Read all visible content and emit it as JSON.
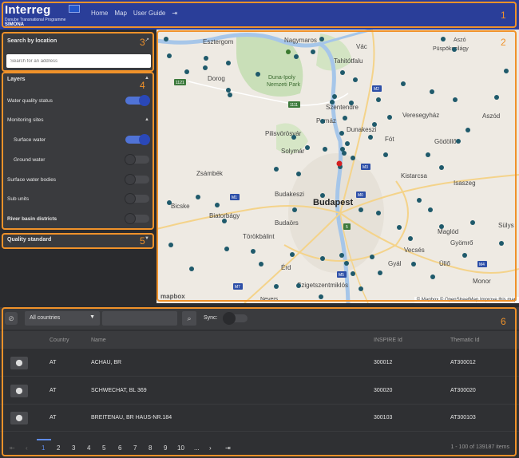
{
  "header": {
    "brand": "Interreg",
    "subtitle": "Danube Transnational Programme",
    "app_name": "SIMONA",
    "nav": [
      "Home",
      "Map",
      "User Guide"
    ],
    "logout_icon": "logout-icon"
  },
  "search": {
    "title": "Search by location",
    "placeholder": "Search for an address"
  },
  "layers": {
    "title": "Layers",
    "water_quality_status": "Water quality status",
    "monitoring_sites": "Monitoring sites",
    "surface_water": "Surface water",
    "ground_water": "Ground water",
    "surface_water_bodies": "Surface water bodies",
    "sub_units": "Sub units",
    "river_basin_districts": "River basin districts"
  },
  "quality": {
    "title": "Quality standard"
  },
  "map": {
    "labels": {
      "esztergom": "Esztergom",
      "nagymaros": "Nagymaros",
      "vac": "Vác",
      "tahitotfalu": "Tahitótfalu",
      "dorog": "Dorog",
      "duna_ipoly_1": "Duna-Ipoly",
      "duna_ipoly_2": "Nemzeti Park",
      "szentendre": "Szentendre",
      "pomaz": "Pomáz",
      "dunakeszi": "Dunakeszi",
      "veresegyhaz": "Veresegyház",
      "aszod": "Aszód",
      "pilisvorosvar": "Pilisvörösvár",
      "solymar": "Solymár",
      "fot": "Fót",
      "godollo": "Gödöllő",
      "zsambek": "Zsámbék",
      "kistarcsa": "Kistarcsa",
      "isaszeg": "Isaszeg",
      "budakeszi": "Budakeszi",
      "budapest": "Budapest",
      "bicske": "Bicske",
      "biatorbagy": "Biatorbágy",
      "budaors": "Budaörs",
      "torokbalint": "Törökbálint",
      "maglod": "Maglód",
      "gyomro": "Gyömrő",
      "sulys": "Sülys",
      "erd": "Érd",
      "vecses": "Vecsés",
      "ullo": "Üllő",
      "gyal": "Gyál",
      "szigetszentmiklos": "Szigetszentmiklós",
      "monor": "Monor",
      "asa": "Aszó",
      "puspokszilagy": "Püspökszilágy",
      "nevers": "Nevers"
    },
    "roads": [
      "1121",
      "1111",
      "M2",
      "M3",
      "M1",
      "M0",
      "5",
      "M4",
      "M5",
      "M7"
    ],
    "logo": "mapbox",
    "attribution": "© Mapbox © OpenStreetMap Improve this map"
  },
  "table": {
    "country_select": "All countries",
    "sync_label": "Sync:",
    "columns": [
      "Country",
      "Name",
      "INSPIRE Id",
      "Thematic Id"
    ],
    "rows": [
      {
        "country": "AT",
        "name": "ACHAU, BR",
        "inspire": "300012",
        "thematic": "AT300012"
      },
      {
        "country": "AT",
        "name": "SCHWECHAT, BL 369",
        "inspire": "300020",
        "thematic": "AT300020"
      },
      {
        "country": "AT",
        "name": "BREITENAU, BR HAUS-NR.184",
        "inspire": "300103",
        "thematic": "AT300103"
      }
    ],
    "pages": [
      "1",
      "2",
      "3",
      "4",
      "5",
      "6",
      "7",
      "8",
      "9",
      "10",
      "..."
    ],
    "items_text": "1 - 100 of 139187 items"
  },
  "annotations": [
    "1",
    "2",
    "3",
    "4",
    "5",
    "6"
  ],
  "colors": {
    "header": "#2a3e99",
    "accent": "#f0922a",
    "toggle_on": "#2a48b8",
    "marker": "#1f5a6b",
    "marker_selected": "#d42020"
  }
}
